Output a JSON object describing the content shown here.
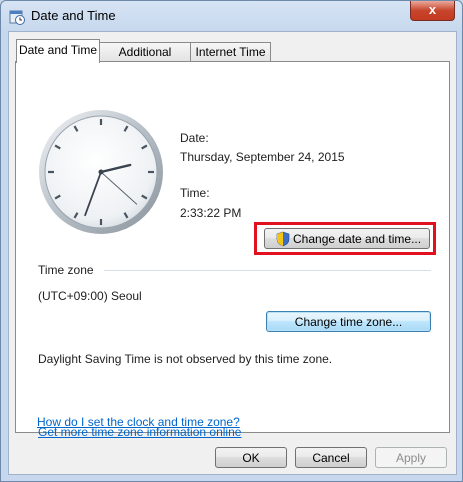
{
  "window": {
    "title": "Date and Time",
    "close_label": "x"
  },
  "tabs": [
    {
      "label": "Date and Time",
      "active": true
    },
    {
      "label": "Additional Clocks",
      "active": false
    },
    {
      "label": "Internet Time",
      "active": false
    }
  ],
  "date": {
    "label": "Date:",
    "value": "Thursday, September 24, 2015"
  },
  "time": {
    "label": "Time:",
    "value": "2:33:22 PM"
  },
  "change_datetime_label": "Change date and time...",
  "timezone": {
    "heading": "Time zone",
    "value": "(UTC+09:00) Seoul",
    "change_label": "Change time zone...",
    "dst_note": "Daylight Saving Time is not observed by this time zone."
  },
  "links": {
    "more_info": "Get more time zone information online",
    "how_to": "How do I set the clock and time zone?"
  },
  "footer": {
    "ok": "OK",
    "cancel": "Cancel",
    "apply": "Apply"
  },
  "colors": {
    "highlight": "#e2111f",
    "link": "#0066cc"
  }
}
